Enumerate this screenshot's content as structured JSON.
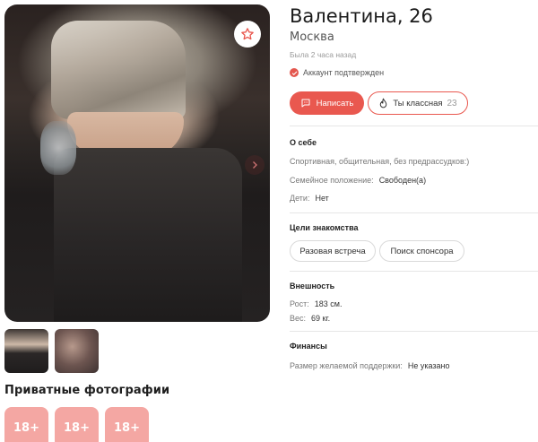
{
  "profile": {
    "name_age": "Валентина, 26",
    "city": "Москва",
    "last_seen": "Была 2 часа назад",
    "verified": "Аккаунт подтвержден"
  },
  "actions": {
    "write_label": "Написать",
    "like_label": "Ты классная",
    "like_count": "23"
  },
  "about": {
    "title": "О себе",
    "description": "Спортивная, общительная, без предрассудков:)",
    "marital_label": "Семейное положение:",
    "marital_value": "Свободен(а)",
    "kids_label": "Дети:",
    "kids_value": "Нет"
  },
  "goals": {
    "title": "Цели знакомства",
    "items": [
      "Разовая встреча",
      "Поиск спонсора"
    ]
  },
  "appearance": {
    "title": "Внешность",
    "height_label": "Рост:",
    "height_value": "183 см.",
    "weight_label": "Вес:",
    "weight_value": "69 кг."
  },
  "finance": {
    "title": "Финансы",
    "support_label": "Размер желаемой поддержки:",
    "support_value": "Не указано"
  },
  "private": {
    "title": "Приватные фотографии",
    "tiles": [
      "18+",
      "18+",
      "18+"
    ]
  },
  "colors": {
    "accent": "#e9584f",
    "private_tile": "#f4a7a3"
  }
}
